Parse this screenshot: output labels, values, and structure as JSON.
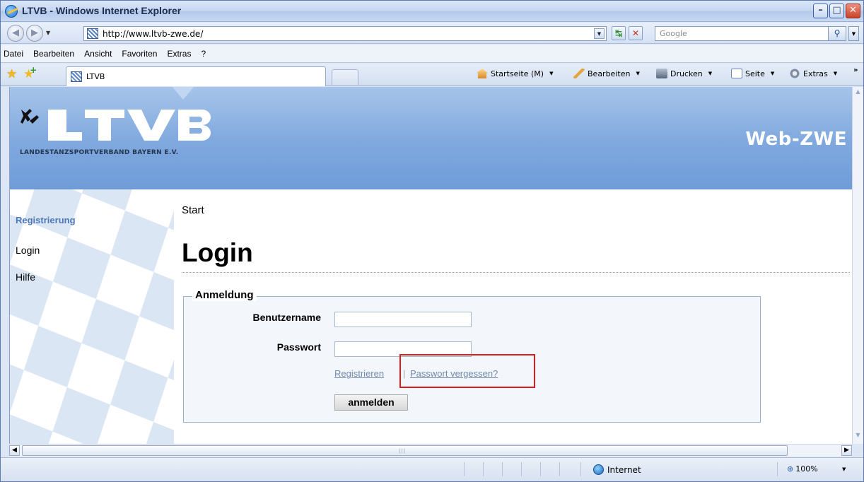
{
  "window": {
    "title": "LTVB - Windows Internet Explorer"
  },
  "address": {
    "url": "http://www.ltvb-zwe.de/",
    "search_placeholder": "Google"
  },
  "menu": [
    "Datei",
    "Bearbeiten",
    "Ansicht",
    "Favoriten",
    "Extras",
    "?"
  ],
  "tab": {
    "label": "LTVB"
  },
  "commands": {
    "home": "Startseite (M)",
    "edit": "Bearbeiten",
    "print": "Drucken",
    "page": "Seite",
    "tools": "Extras"
  },
  "site": {
    "logo_text": "LTVB",
    "logo_tagline": "LANDESTANZSPORTVERBAND BAYERN E.V.",
    "brand_right": "Web-ZWE"
  },
  "sidebar": {
    "items": [
      "Registrierung",
      "Login",
      "Hilfe"
    ]
  },
  "breadcrumb": "Start",
  "page_title": "Login",
  "form": {
    "legend": "Anmeldung",
    "username_label": "Benutzername",
    "password_label": "Passwort",
    "register_link": "Registrieren",
    "forgot_link": "Passwort vergessen?",
    "submit_label": "anmelden"
  },
  "status": {
    "zone": "Internet",
    "zoom": "100%"
  },
  "colors": {
    "banner": "#7fa8de",
    "link": "#6f8ab0",
    "sidebar_active": "#4d78b6",
    "highlight": "#e01b1b"
  }
}
